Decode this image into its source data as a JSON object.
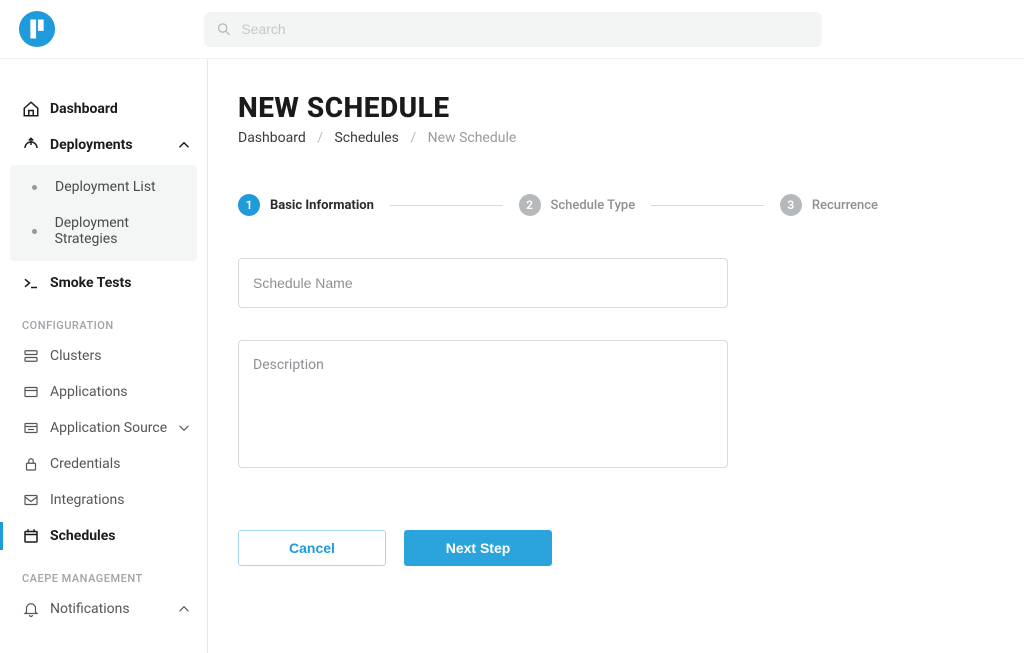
{
  "search": {
    "placeholder": "Search"
  },
  "sidebar": {
    "top_items": [
      {
        "label": "Dashboard"
      },
      {
        "label": "Deployments"
      }
    ],
    "deployments_sub": [
      {
        "label": "Deployment List"
      },
      {
        "label": "Deployment Strategies"
      }
    ],
    "smoke_tests": {
      "label": "Smoke Tests"
    },
    "config_label": "CONFIGURATION",
    "config_items": [
      {
        "label": "Clusters"
      },
      {
        "label": "Applications"
      },
      {
        "label": "Application Source"
      },
      {
        "label": "Credentials"
      },
      {
        "label": "Integrations"
      },
      {
        "label": "Schedules"
      }
    ],
    "mgmt_label": "CAEPE MANAGEMENT",
    "mgmt_items": [
      {
        "label": "Notifications"
      }
    ]
  },
  "page": {
    "title": "NEW SCHEDULE",
    "breadcrumb": [
      "Dashboard",
      "Schedules",
      "New Schedule"
    ]
  },
  "stepper": {
    "steps": [
      {
        "num": "1",
        "label": "Basic Information"
      },
      {
        "num": "2",
        "label": "Schedule Type"
      },
      {
        "num": "3",
        "label": "Recurrence"
      }
    ]
  },
  "form": {
    "name_placeholder": "Schedule Name",
    "desc_placeholder": "Description",
    "cancel_label": "Cancel",
    "next_label": "Next Step"
  }
}
